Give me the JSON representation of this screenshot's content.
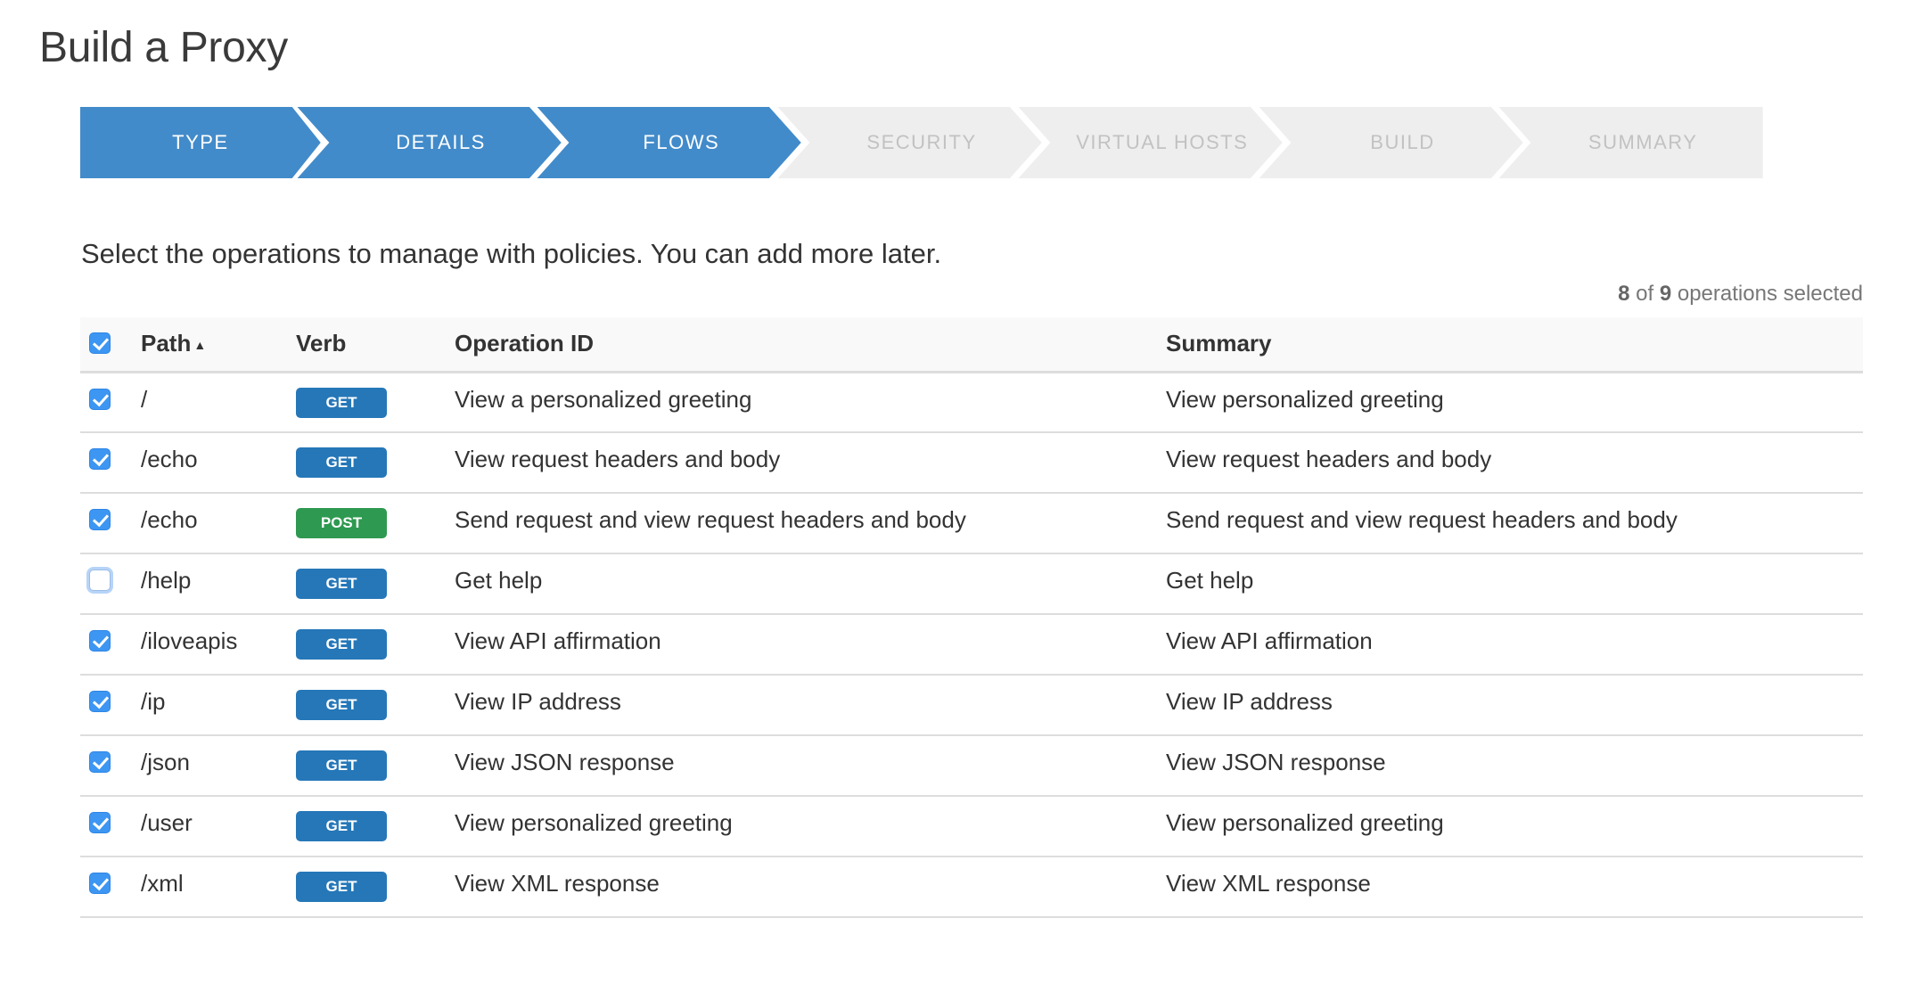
{
  "page_title": "Build a Proxy",
  "wizard": {
    "steps": [
      {
        "label": "TYPE",
        "state": "done"
      },
      {
        "label": "DETAILS",
        "state": "done"
      },
      {
        "label": "FLOWS",
        "state": "current"
      },
      {
        "label": "SECURITY",
        "state": "todo"
      },
      {
        "label": "VIRTUAL HOSTS",
        "state": "todo"
      },
      {
        "label": "BUILD",
        "state": "todo"
      },
      {
        "label": "SUMMARY",
        "state": "todo"
      }
    ],
    "colors": {
      "active": "#428bca",
      "inactive": "#eeeeee",
      "separator": "#ffffff"
    }
  },
  "intro_text": "Select the operations to manage with policies. You can add more later.",
  "counter": {
    "selected": "8",
    "of_text": "of",
    "total": "9",
    "suffix": "operations selected"
  },
  "table": {
    "select_all_checked": true,
    "headers": {
      "path": "Path",
      "path_sort_icon": "▲",
      "verb": "Verb",
      "operation_id": "Operation ID",
      "summary": "Summary"
    },
    "verb_colors": {
      "GET": "#2577b8",
      "POST": "#2e9950"
    },
    "rows": [
      {
        "checked": true,
        "path": "/",
        "verb": "GET",
        "operation_id": "View a personalized greeting",
        "summary": "View personalized greeting"
      },
      {
        "checked": true,
        "path": "/echo",
        "verb": "GET",
        "operation_id": "View request headers and body",
        "summary": "View request headers and body"
      },
      {
        "checked": true,
        "path": "/echo",
        "verb": "POST",
        "operation_id": "Send request and view request headers and body",
        "summary": "Send request and view request headers and body"
      },
      {
        "checked": false,
        "path": "/help",
        "verb": "GET",
        "operation_id": "Get help",
        "summary": "Get help"
      },
      {
        "checked": true,
        "path": "/iloveapis",
        "verb": "GET",
        "operation_id": "View API affirmation",
        "summary": "View API affirmation"
      },
      {
        "checked": true,
        "path": "/ip",
        "verb": "GET",
        "operation_id": "View IP address",
        "summary": "View IP address"
      },
      {
        "checked": true,
        "path": "/json",
        "verb": "GET",
        "operation_id": "View JSON response",
        "summary": "View JSON response"
      },
      {
        "checked": true,
        "path": "/user",
        "verb": "GET",
        "operation_id": "View personalized greeting",
        "summary": "View personalized greeting"
      },
      {
        "checked": true,
        "path": "/xml",
        "verb": "GET",
        "operation_id": "View XML response",
        "summary": "View XML response"
      }
    ]
  }
}
